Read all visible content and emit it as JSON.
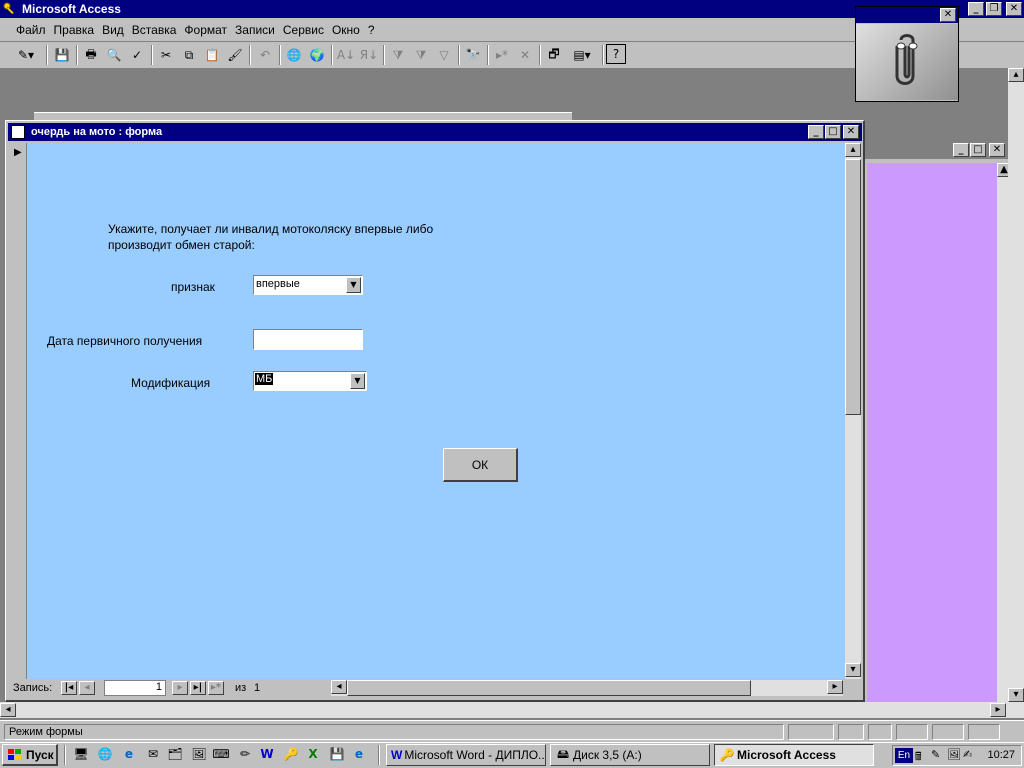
{
  "app": {
    "title": "Microsoft Access"
  },
  "menu": [
    {
      "label": "Файл"
    },
    {
      "label": "Правка"
    },
    {
      "label": "Вид"
    },
    {
      "label": "Вставка"
    },
    {
      "label": "Формат"
    },
    {
      "label": "Записи"
    },
    {
      "label": "Сервис"
    },
    {
      "label": "Окно"
    },
    {
      "label": "?"
    }
  ],
  "form_window": {
    "title": "очердь на мото : форма",
    "instruction_line1": "Укажите, получает ли инвалид мотоколяску впервые либо",
    "instruction_line2": "производит обмен старой:",
    "priznak_label": "признак",
    "priznak_value": "впервые",
    "date_label": "Дата первичного получения",
    "date_value": "",
    "mod_label": "Модификация",
    "mod_value": "МБ",
    "ok_label": "ОК"
  },
  "navigation": {
    "record_label": "Запись:",
    "record_number": "1",
    "of_label": "из",
    "total": "1"
  },
  "statusbar": {
    "text": "Режим формы"
  },
  "taskbar": {
    "start_label": "Пуск",
    "tasks": [
      {
        "label": "Microsoft Word - ДИПЛО..."
      },
      {
        "label": "Диск 3,5 (A:)"
      },
      {
        "label": "Microsoft Access"
      }
    ],
    "lang": "En",
    "clock": "10:27"
  },
  "colors": {
    "title_bar": "#000080",
    "form_background": "#99ccff",
    "side_window": "#cc99ff",
    "chrome": "#c0c0c0"
  }
}
